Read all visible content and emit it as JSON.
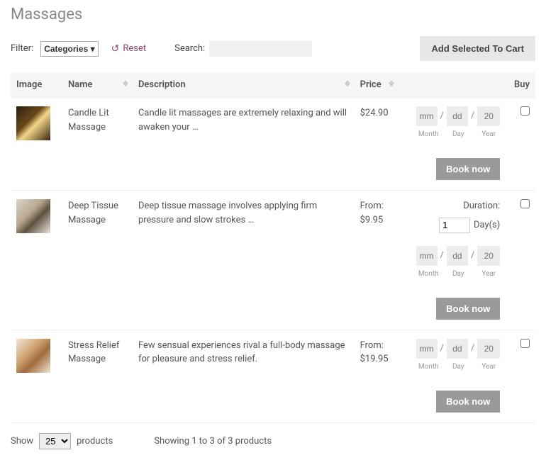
{
  "page_title": "Massages",
  "toolbar": {
    "filter_label": "Filter:",
    "categories_label": "Categories",
    "reset_label": "Reset",
    "search_label": "Search:",
    "search_value": "",
    "add_to_cart_label": "Add Selected To Cart"
  },
  "headers": {
    "image": "Image",
    "name": "Name",
    "description": "Description",
    "price": "Price",
    "buy": "Buy"
  },
  "date_picker": {
    "month_ph": "mm",
    "day_ph": "dd",
    "year_ph": "20",
    "month_label": "Month",
    "day_label": "Day",
    "year_label": "Year",
    "slash": "/"
  },
  "duration": {
    "label": "Duration:",
    "value": "1",
    "unit": "Day(s)"
  },
  "book_label": "Book now",
  "rows": [
    {
      "name": "Candle Lit Massage",
      "description": "Candle lit massages are extremely relaxing and will awaken your …",
      "price": "$24.90",
      "from": false
    },
    {
      "name": "Deep Tissue Massage",
      "description": "Deep tissue massage involves applying firm pressure and slow strokes …",
      "price": "$9.95",
      "from": true
    },
    {
      "name": "Stress Relief Massage",
      "description": "Few sensual experiences rival a full-body massage for pleasure and stress relief.",
      "price": "$19.95",
      "from": true
    }
  ],
  "price_prefix": "From:",
  "footer": {
    "show_label": "Show",
    "page_size": "25",
    "products_label": "products",
    "showing": "Showing 1 to 3 of 3 products"
  }
}
